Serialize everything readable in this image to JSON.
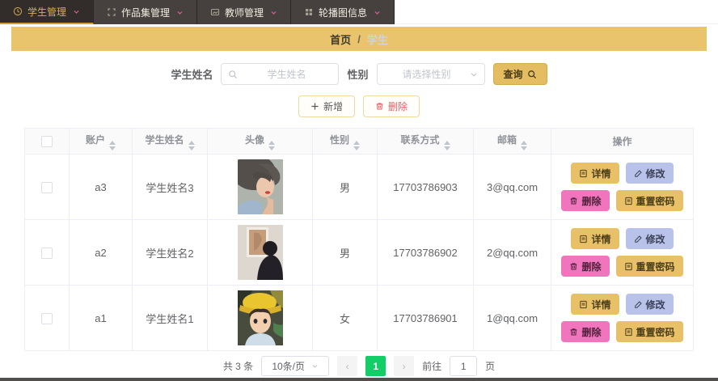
{
  "nav": {
    "items": [
      {
        "label": "学生管理",
        "icon": "clock-icon",
        "active": true
      },
      {
        "label": "作品集管理",
        "icon": "scan-icon",
        "active": false
      },
      {
        "label": "教师管理",
        "icon": "image-icon",
        "active": false
      },
      {
        "label": "轮播图信息",
        "icon": "grid-icon",
        "active": false
      }
    ]
  },
  "breadcrumb": {
    "home": "首页",
    "separator": "/",
    "current": "学生"
  },
  "search": {
    "name_label": "学生姓名",
    "name_placeholder": "学生姓名",
    "gender_label": "性别",
    "gender_placeholder": "请选择性别",
    "query_label": "查询"
  },
  "actions": {
    "add": "新增",
    "delete": "删除"
  },
  "table": {
    "headers": {
      "account": "账户",
      "name": "学生姓名",
      "avatar": "头像",
      "gender": "性别",
      "contact": "联系方式",
      "email": "邮箱",
      "operation": "操作"
    },
    "rows": [
      {
        "account": "a3",
        "name": "学生姓名3",
        "gender": "男",
        "contact": "17703786903",
        "email": "3@qq.com"
      },
      {
        "account": "a2",
        "name": "学生姓名2",
        "gender": "男",
        "contact": "17703786902",
        "email": "2@qq.com"
      },
      {
        "account": "a1",
        "name": "学生姓名1",
        "gender": "女",
        "contact": "17703786901",
        "email": "1@qq.com"
      }
    ],
    "row_buttons": {
      "detail": "详情",
      "edit": "修改",
      "delete": "删除",
      "reset": "重置密码"
    }
  },
  "pagination": {
    "total": "共 3 条",
    "page_size": "10条/页",
    "prev": "‹",
    "next": "›",
    "current_page": "1",
    "goto_label": "前往",
    "goto_value": "1",
    "goto_suffix": "页"
  },
  "colors": {
    "accent_gold": "#e4bc62",
    "breadcrumb_bg": "#e9c46d",
    "nav_chevron_pink": "#d85f98",
    "chip_blue": "#b9c3ea",
    "chip_pink": "#f075bd",
    "delete_red": "#e85d63",
    "pagination_green": "#13ce66"
  }
}
